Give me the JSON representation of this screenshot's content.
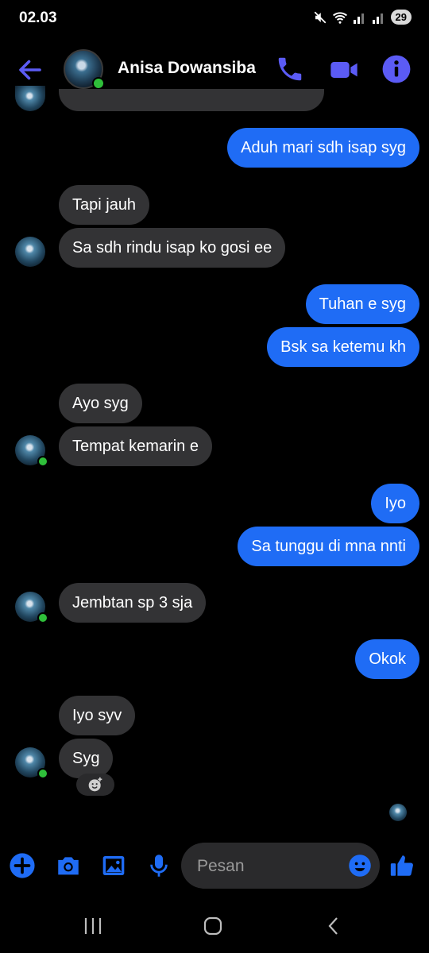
{
  "status_bar": {
    "time": "02.03",
    "battery": "29"
  },
  "header": {
    "contact_name": "Anisa Dowansiba"
  },
  "messages": [
    {
      "text": "Aduh mari sdh isap syg"
    },
    {
      "text": "Tapi jauh"
    },
    {
      "text": "Sa sdh rindu isap ko gosi ee"
    },
    {
      "text": "Tuhan e syg"
    },
    {
      "text": "Bsk sa ketemu kh"
    },
    {
      "text": "Ayo syg"
    },
    {
      "text": "Tempat kemarin e"
    },
    {
      "text": "Iyo"
    },
    {
      "text": "Sa tunggu di mna nnti"
    },
    {
      "text": "Jembtan sp 3 sja"
    },
    {
      "text": "Okok"
    },
    {
      "text": "Iyo syv"
    },
    {
      "text": "Syg"
    }
  ],
  "composer": {
    "placeholder": "Pesan"
  },
  "colors": {
    "accent": "#5b5bf5",
    "outgoing": "#1f6cf5",
    "incoming": "#333335",
    "online": "#2fbf3a"
  },
  "icons": [
    "back-arrow-icon",
    "phone-icon",
    "video-icon",
    "info-icon",
    "plus-icon",
    "camera-icon",
    "image-icon",
    "mic-icon",
    "emoji-icon",
    "thumbs-up-icon",
    "add-reaction-icon"
  ]
}
